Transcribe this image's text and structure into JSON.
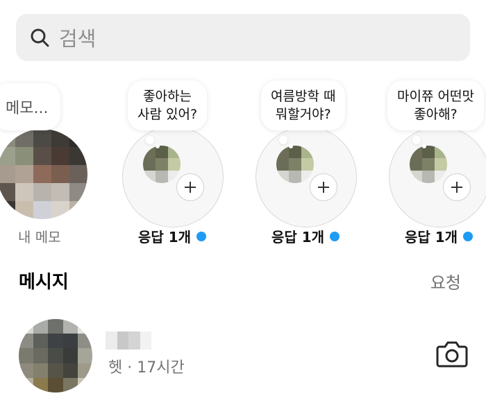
{
  "search": {
    "placeholder": "검색",
    "icon": "search-icon"
  },
  "notes": {
    "my_note": {
      "bubble": "메모...",
      "label": "내 메모"
    },
    "items": [
      {
        "text_line1": "좋아하는",
        "text_line2": "사람 있어?",
        "label": "응답 1개"
      },
      {
        "text_line1": "여름방학 때",
        "text_line2": "뭐할거야?",
        "label": "응답 1개"
      },
      {
        "text_line1": "마이쮸 어떤맛",
        "text_line2": "좋아해?",
        "label": "응답 1개"
      }
    ]
  },
  "messages": {
    "title": "메시지",
    "requests_label": "요청",
    "conversations": [
      {
        "preview": "헷 · 17시간"
      }
    ]
  },
  "colors": {
    "accent_dot": "#1e9bf5",
    "search_bg": "#efefef",
    "muted_text": "#737373"
  }
}
